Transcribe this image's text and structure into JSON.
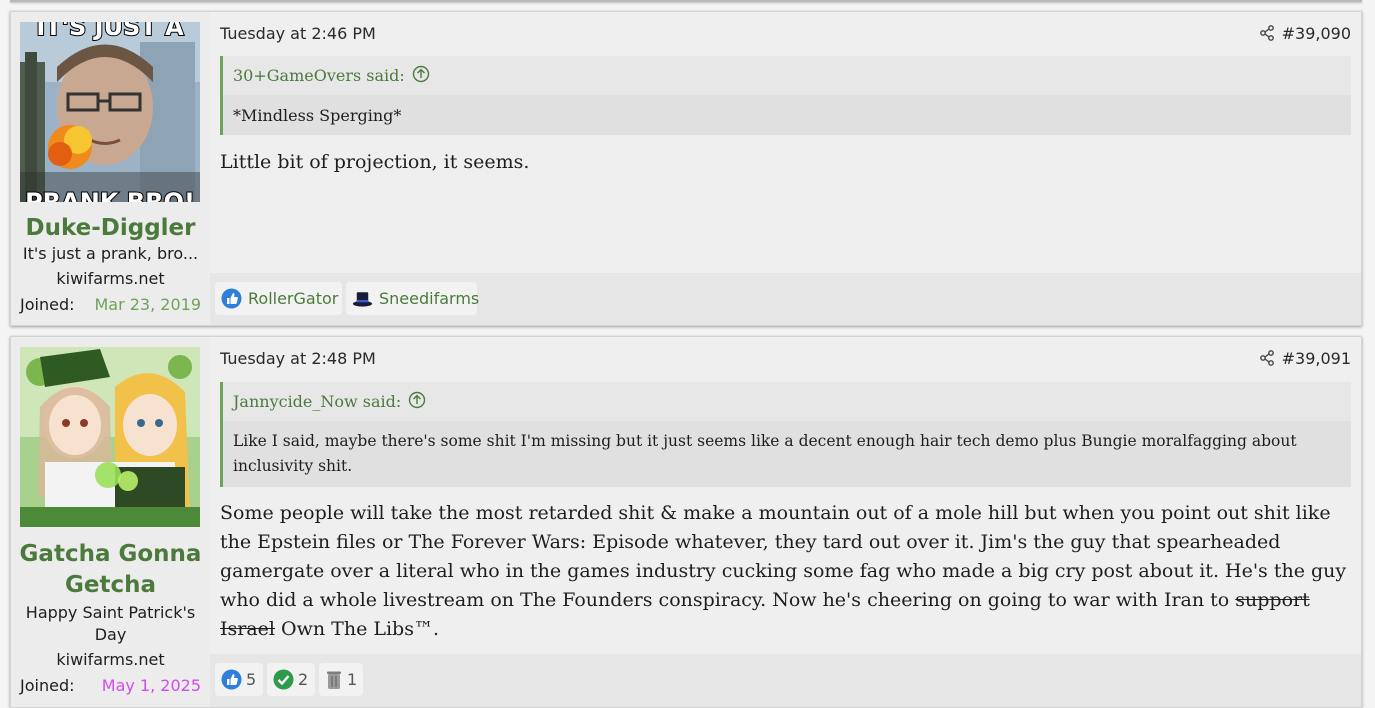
{
  "posts": [
    {
      "user": {
        "avatar_caption_top": "IT'S JUST A",
        "avatar_caption_bottom": "PRANK BRO!",
        "name": "Duke-Diggler",
        "title": "It's just a prank, bro...",
        "site": "kiwifarms.net",
        "joined_label": "Joined:",
        "joined_date": "Mar 23, 2019"
      },
      "date": "Tuesday at 2:46 PM",
      "number": "#39,090",
      "quote": {
        "author": "30+GameOvers said:",
        "text": "*Mindless Sperging*"
      },
      "message": "Little bit of projection, it seems.",
      "reactions": [
        {
          "icon": "like-icon",
          "label": "RollerGator"
        },
        {
          "icon": "top-hat-icon",
          "label": "Sneedifarms"
        }
      ]
    },
    {
      "user": {
        "name": "Gatcha Gonna Getcha",
        "title": "Happy Saint Patrick's Day",
        "site": "kiwifarms.net",
        "joined_label": "Joined:",
        "joined_date": "May 1, 2025"
      },
      "date": "Tuesday at 2:48 PM",
      "number": "#39,091",
      "quote": {
        "author": "Jannycide_Now said:",
        "text": "Like I said, maybe there's some shit I'm missing but it just seems like a decent enough hair tech demo plus Bungie moralfagging about inclusivity shit."
      },
      "message_before": "Some people will take the most retarded shit & make a mountain out of a mole hill but when you point out shit like the Epstein files or The Forever Wars: Episode whatever, they tard out over it. Jim's the guy that spearheaded gamergate over a literal who in the games industry cucking some fag who made a big cry post about it. He's the guy who did a whole livestream on The Founders conspiracy. Now he's cheering on going to war with Iran to ",
      "message_struck": "support Israel",
      "message_after": " Own The Libs™.",
      "reactions": [
        {
          "icon": "like-icon",
          "count": "5"
        },
        {
          "icon": "check-icon",
          "count": "2"
        },
        {
          "icon": "trash-can-icon",
          "count": "1"
        }
      ]
    }
  ],
  "colors": {
    "username": "#4b7a3c",
    "joined_date_1": "#6ea35a",
    "joined_date_2": "#d24bf0",
    "quote_border": "#6ea35a"
  }
}
